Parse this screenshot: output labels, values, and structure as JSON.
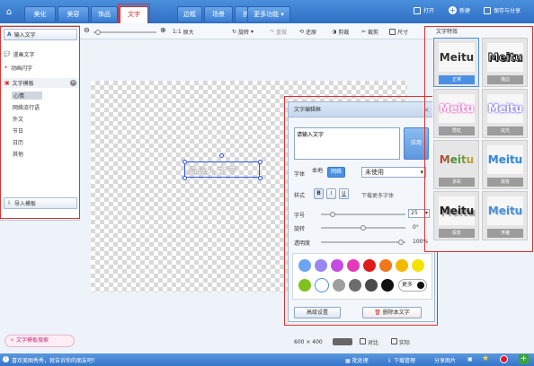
{
  "tabs": [
    {
      "label": "美化"
    },
    {
      "label": "美容"
    },
    {
      "label": "饰品"
    },
    {
      "label": "文字"
    },
    {
      "label": "边框"
    },
    {
      "label": "场景"
    },
    {
      "label": "拼图"
    },
    {
      "label": "更多功能"
    }
  ],
  "top_right": {
    "open": "打开",
    "new": "新建",
    "save_share": "保存与分享"
  },
  "toolbar": {
    "zoom_ratio": "1:1",
    "original": "原大",
    "rotate": "旋转",
    "cut": "剪裁",
    "crop": "裁剪",
    "size": "尺寸",
    "redo": "重做",
    "reset": "还原"
  },
  "left": {
    "input_text": "输入文字",
    "comic_text": "漫画文字",
    "animated_text": "动画闪字",
    "template": "文字模板",
    "categories": [
      "心情",
      "网络流行语",
      "外文",
      "节日",
      "日历",
      "其他"
    ],
    "import_template": "导入模板",
    "template_search": "文字模板搜索"
  },
  "canvas": {
    "placeholder_text": "请输入文字",
    "size": "600 × 400",
    "compare": "对比",
    "real_size": "实际"
  },
  "editor": {
    "title": "文字编辑框",
    "text_value": "请输入文字",
    "apply": "应用",
    "font_label": "字体",
    "font_local": "本地",
    "font_online": "网络",
    "font_select": "未使用",
    "style_label": "样式",
    "bold": "B",
    "italic": "I",
    "underline": "U",
    "download_font": "下载更多字体",
    "size_label": "字号",
    "size_value": "25",
    "rotate_label": "旋转",
    "rotate_value": "0°",
    "opacity_label": "透明度",
    "opacity_value": "100%",
    "more_colors": "更多",
    "advanced": "高级设置",
    "delete_text": "删除本文字"
  },
  "colors": {
    "row1": [
      "#6aa4f2",
      "#9a86f0",
      "#c64be0",
      "#e43bb8",
      "#e01919",
      "#f0781a",
      "#f3b800",
      "#f3e300"
    ],
    "row2": [
      "#7fc21e",
      "#ffffff",
      "#9e9e9e",
      "#6d6d6d",
      "#4a4a4a",
      "#111111"
    ]
  },
  "right": {
    "title": "文字特效",
    "styles": [
      {
        "label": "正常",
        "text": "Meitu",
        "color": "#333333"
      },
      {
        "label": "描边",
        "text": "Meitu",
        "color": "#111111"
      },
      {
        "label": "霓虹",
        "text": "Meitu",
        "color": "#e85ac6"
      },
      {
        "label": "炫光",
        "text": "Meitu",
        "color": "#6a63e6"
      },
      {
        "label": "多彩",
        "text": "Meitu",
        "color": "#e03030"
      },
      {
        "label": "渐变",
        "text": "Meitu",
        "color": "#3a8ad8"
      },
      {
        "label": "投影",
        "text": "Meitu",
        "color": "#222222"
      },
      {
        "label": "浮雕",
        "text": "Meitu",
        "color": "#4d8fcf"
      }
    ]
  },
  "status": {
    "left": "喜欢美图秀秀，就告诉你的朋友吧！",
    "batch": "批处理",
    "download": "下载管理",
    "share": "分享图片"
  }
}
